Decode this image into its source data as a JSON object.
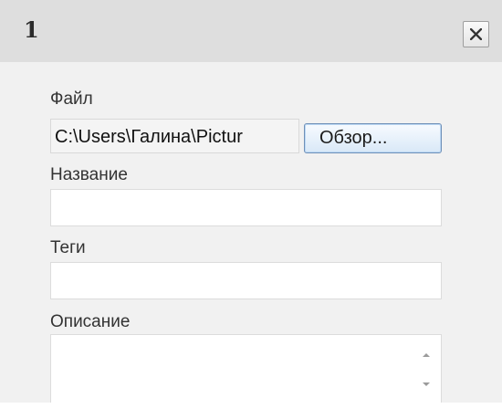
{
  "dialog": {
    "title": "1",
    "close_icon": "close-icon"
  },
  "form": {
    "file": {
      "label": "Файл",
      "value": "C:\\Users\\Галина\\Pictur",
      "browse_label": "Обзор..."
    },
    "name": {
      "label": "Название",
      "value": ""
    },
    "tags": {
      "label": "Теги",
      "value": ""
    },
    "description": {
      "label": "Описание",
      "value": "",
      "scroll_up_icon": "triangle-up-icon",
      "scroll_down_icon": "triangle-down-icon"
    }
  },
  "colors": {
    "titlebar": "#dedede",
    "dialog_background": "#f1f1f1",
    "browse_border": "#6f90b8"
  }
}
